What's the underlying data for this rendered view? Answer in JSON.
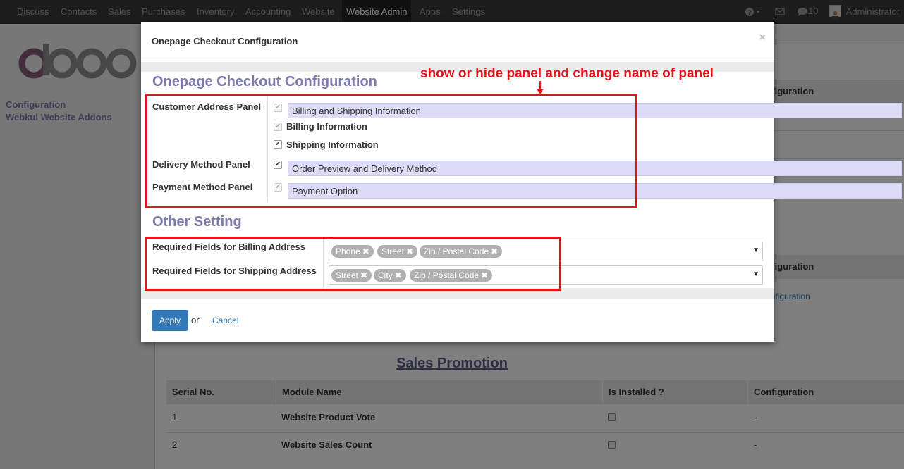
{
  "navbar": {
    "items": [
      "Discuss",
      "Contacts",
      "Sales",
      "Purchases",
      "Inventory",
      "Accounting",
      "Website",
      "Website Admin",
      "Apps",
      "Settings"
    ],
    "messages_count": "10",
    "user": "Administrator"
  },
  "sidebar": {
    "logo_text": "odoo",
    "links": [
      "Configuration",
      "Webkul Website Addons"
    ]
  },
  "background": {
    "header_config": "Configuration",
    "link_partial": "onfiguration",
    "sales_promotion_title": "Sales Promotion",
    "table_headers": [
      "Serial No.",
      "Module Name",
      "Is Installed ?",
      "Configuration"
    ],
    "rows": [
      {
        "serial": "1",
        "module": "Website Product Vote",
        "installed": false,
        "config": "-"
      },
      {
        "serial": "2",
        "module": "Website Sales Count",
        "installed": false,
        "config": "-"
      }
    ]
  },
  "modal": {
    "title": "Onepage Checkout Configuration",
    "close_symbol": "×",
    "section1_title": "Onepage Checkout Configuration",
    "customer_address_label": "Customer Address Panel",
    "customer_address_value": "Billing and Shipping Information",
    "billing_info_label": "Billing Information",
    "shipping_info_label": "Shipping Information",
    "delivery_method_label": "Delivery Method Panel",
    "delivery_method_value": "Order Preview and Delivery Method",
    "payment_method_label": "Payment Method Panel",
    "payment_method_value": "Payment Option",
    "section2_title": "Other Setting",
    "billing_required_label": "Required Fields for Billing Address",
    "billing_required_tags": [
      "Phone",
      "Street",
      "Zip / Postal Code"
    ],
    "shipping_required_label": "Required Fields for Shipping Address",
    "shipping_required_tags": [
      "Street",
      "City",
      "Zip / Postal Code"
    ],
    "apply_label": "Apply",
    "or_label": "or",
    "cancel_label": "Cancel"
  },
  "annotation": {
    "text": "show or hide panel and change name of panel",
    "color": "#e0141a"
  },
  "colors": {
    "navbar_bg": "#3a3a3a",
    "accent_purple": "#7c7bad",
    "input_bg": "#dcdcf7",
    "apply_blue": "#337ab7"
  }
}
